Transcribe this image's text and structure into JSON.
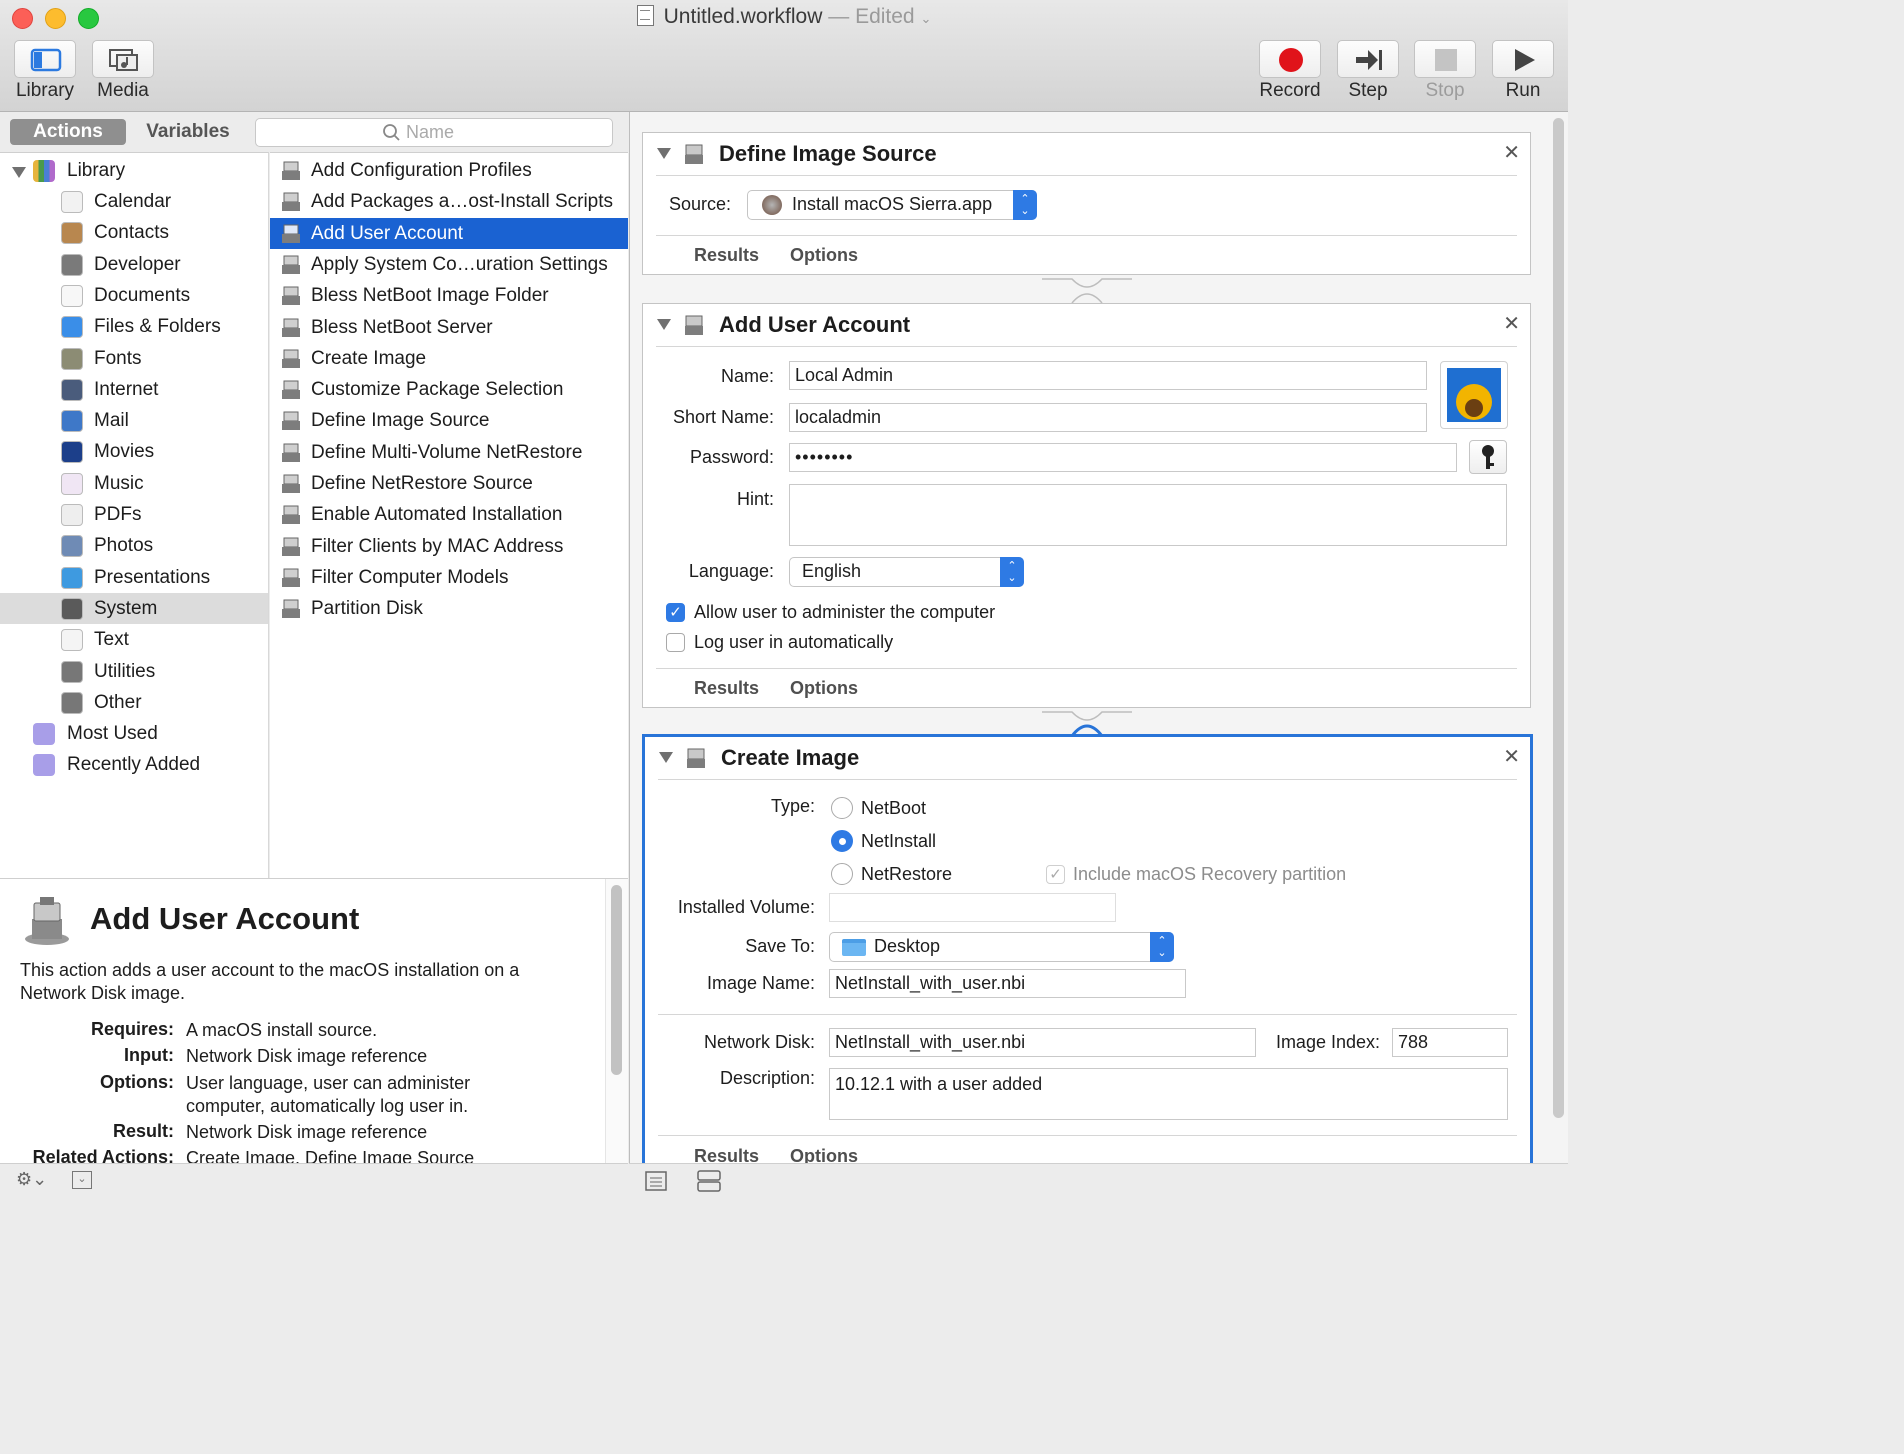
{
  "window": {
    "title": "Untitled.workflow",
    "separator": "—",
    "status": "Edited"
  },
  "toolbar": {
    "library_label": "Library",
    "media_label": "Media",
    "record_label": "Record",
    "step_label": "Step",
    "stop_label": "Stop",
    "run_label": "Run"
  },
  "left_tabs": {
    "actions_label": "Actions",
    "variables_label": "Variables",
    "search_placeholder": "Name"
  },
  "library": {
    "root_label": "Library",
    "items": [
      {
        "label": "Calendar",
        "icon": "calendar-icon"
      },
      {
        "label": "Contacts",
        "icon": "contacts-icon"
      },
      {
        "label": "Developer",
        "icon": "developer-icon"
      },
      {
        "label": "Documents",
        "icon": "documents-icon"
      },
      {
        "label": "Files & Folders",
        "icon": "finder-icon"
      },
      {
        "label": "Fonts",
        "icon": "fonts-icon"
      },
      {
        "label": "Internet",
        "icon": "internet-icon"
      },
      {
        "label": "Mail",
        "icon": "mail-icon"
      },
      {
        "label": "Movies",
        "icon": "movies-icon"
      },
      {
        "label": "Music",
        "icon": "music-icon"
      },
      {
        "label": "PDFs",
        "icon": "pdf-icon"
      },
      {
        "label": "Photos",
        "icon": "photos-icon"
      },
      {
        "label": "Presentations",
        "icon": "presentations-icon"
      },
      {
        "label": "System",
        "icon": "system-icon"
      },
      {
        "label": "Text",
        "icon": "text-icon"
      },
      {
        "label": "Utilities",
        "icon": "utilities-icon"
      },
      {
        "label": "Other",
        "icon": "other-icon"
      }
    ],
    "smart_groups": [
      {
        "label": "Most Used"
      },
      {
        "label": "Recently Added"
      }
    ],
    "selected": "System"
  },
  "actions": {
    "items": [
      "Add Configuration Profiles",
      "Add Packages a…ost-Install Scripts",
      "Add User Account",
      "Apply System Co…uration Settings",
      "Bless NetBoot Image Folder",
      "Bless NetBoot Server",
      "Create Image",
      "Customize Package Selection",
      "Define Image Source",
      "Define Multi-Volume NetRestore",
      "Define NetRestore Source",
      "Enable Automated Installation",
      "Filter Clients by MAC Address",
      "Filter Computer Models",
      "Partition Disk"
    ],
    "selected": "Add User Account"
  },
  "description": {
    "title": "Add User Account",
    "summary": "This action adds a user account to the macOS installation on a Network Disk image.",
    "requires_label": "Requires:",
    "requires": "A macOS install source.",
    "input_label": "Input:",
    "input": "Network Disk image reference",
    "options_label": "Options:",
    "options": "User language, user can administer computer, automatically log user in.",
    "result_label": "Result:",
    "result": "Network Disk image reference",
    "related_label": "Related Actions:",
    "related": "Create Image, Define Image Source"
  },
  "workflow": {
    "define_source": {
      "title": "Define Image Source",
      "source_label": "Source:",
      "source_value": "Install macOS Sierra.app",
      "results_tab": "Results",
      "options_tab": "Options"
    },
    "add_user": {
      "title": "Add User Account",
      "name_label": "Name:",
      "name_value": "Local Admin",
      "short_name_label": "Short Name:",
      "short_name_value": "localadmin",
      "password_label": "Password:",
      "password_value": "••••••••",
      "hint_label": "Hint:",
      "hint_value": "",
      "language_label": "Language:",
      "language_value": "English",
      "admin_label": "Allow user to administer the computer",
      "admin_checked": true,
      "autologin_label": "Log user in automatically",
      "autologin_checked": false,
      "results_tab": "Results",
      "options_tab": "Options"
    },
    "create_image": {
      "title": "Create Image",
      "type_label": "Type:",
      "type_options": [
        "NetBoot",
        "NetInstall",
        "NetRestore"
      ],
      "type_selected": "NetInstall",
      "recovery_label": "Include macOS Recovery partition",
      "installed_volume_label": "Installed Volume:",
      "installed_volume_value": "",
      "save_to_label": "Save To:",
      "save_to_value": "Desktop",
      "image_name_label": "Image Name:",
      "image_name_value": "NetInstall_with_user.nbi",
      "network_disk_label": "Network Disk:",
      "network_disk_value": "NetInstall_with_user.nbi",
      "image_index_label": "Image Index:",
      "image_index_value": "788",
      "description_label": "Description:",
      "description_value": "10.12.1 with a user added",
      "results_tab": "Results",
      "options_tab": "Options"
    }
  },
  "colors": {
    "accent": "#2e7ae4",
    "selection": "#1a62d2",
    "record": "#e0131a"
  }
}
